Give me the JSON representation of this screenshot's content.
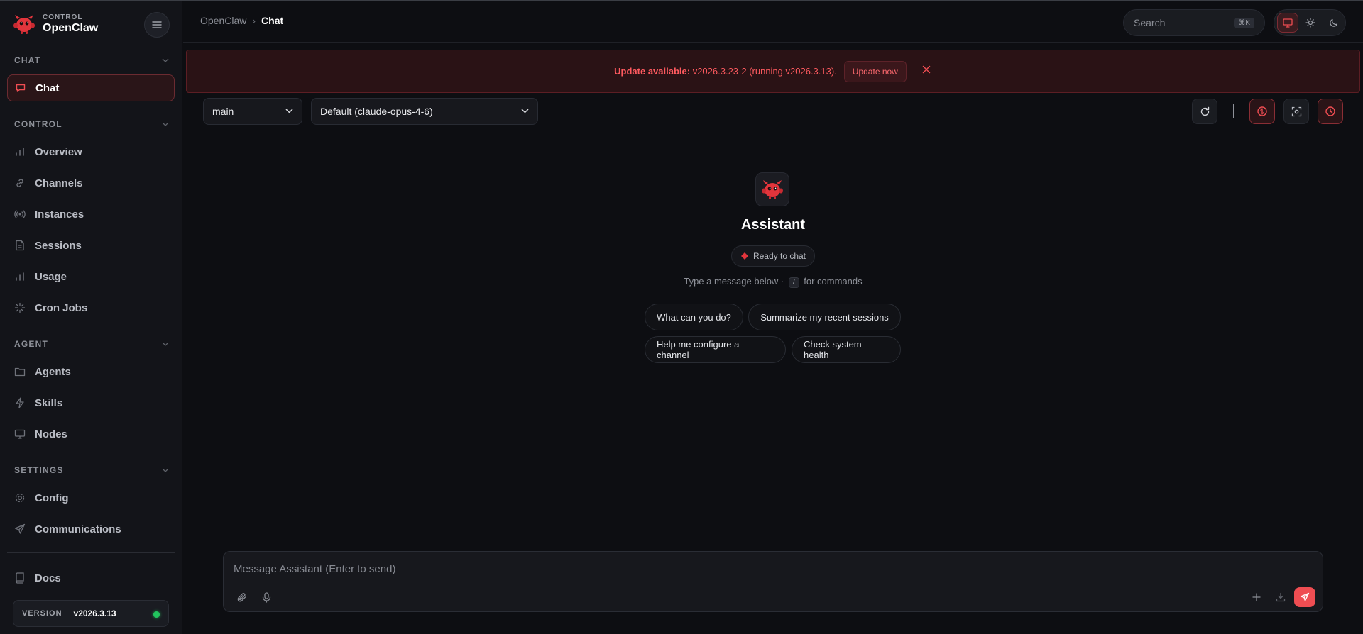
{
  "brand": {
    "sub": "CONTROL",
    "name": "OpenClaw",
    "logo_icon": "claw-mascot-icon",
    "accent": "#ef4d52"
  },
  "sidebar": {
    "sections": [
      {
        "title": "CHAT",
        "items": [
          {
            "label": "Chat",
            "icon": "chat-bubble-icon",
            "active": true
          }
        ]
      },
      {
        "title": "CONTROL",
        "items": [
          {
            "label": "Overview",
            "icon": "bar-chart-icon"
          },
          {
            "label": "Channels",
            "icon": "link-icon"
          },
          {
            "label": "Instances",
            "icon": "radio-icon"
          },
          {
            "label": "Sessions",
            "icon": "document-icon"
          },
          {
            "label": "Usage",
            "icon": "bar-chart-icon"
          },
          {
            "label": "Cron Jobs",
            "icon": "loader-icon"
          }
        ]
      },
      {
        "title": "AGENT",
        "items": [
          {
            "label": "Agents",
            "icon": "folder-icon"
          },
          {
            "label": "Skills",
            "icon": "lightning-icon"
          },
          {
            "label": "Nodes",
            "icon": "monitor-icon"
          }
        ]
      },
      {
        "title": "SETTINGS",
        "items": [
          {
            "label": "Config",
            "icon": "gear-icon"
          },
          {
            "label": "Communications",
            "icon": "send-icon"
          }
        ]
      }
    ],
    "docs": {
      "label": "Docs",
      "icon": "book-icon"
    },
    "version": {
      "label": "VERSION",
      "value": "v2026.3.13",
      "status_color": "#22c55e"
    }
  },
  "header": {
    "breadcrumb": [
      "OpenClaw",
      "Chat"
    ],
    "breadcrumb_sep": "›",
    "search": {
      "placeholder": "Search",
      "shortcut": "⌘K"
    },
    "theme_options": [
      "monitor-icon",
      "sun-icon",
      "moon-icon"
    ]
  },
  "banner": {
    "strong": "Update available:",
    "text": " v2026.3.23-2 (running v2026.3.13).",
    "button": "Update now"
  },
  "toolbar": {
    "agent_select": "main",
    "model_select": "Default (claude-opus-4-6)",
    "icons": [
      "refresh-icon",
      "brain-icon",
      "focus-icon",
      "clock-icon"
    ]
  },
  "welcome": {
    "title": "Assistant",
    "status": "Ready to chat",
    "hint_before": "Type a message below · ",
    "hint_key": "/",
    "hint_after": " for commands",
    "suggestions": [
      "What can you do?",
      "Summarize my recent sessions",
      "Help me configure a channel",
      "Check system health"
    ]
  },
  "composer": {
    "placeholder": "Message Assistant (Enter to send)",
    "icons": [
      "paperclip-icon",
      "microphone-icon",
      "plus-icon",
      "download-icon",
      "send-icon"
    ]
  }
}
